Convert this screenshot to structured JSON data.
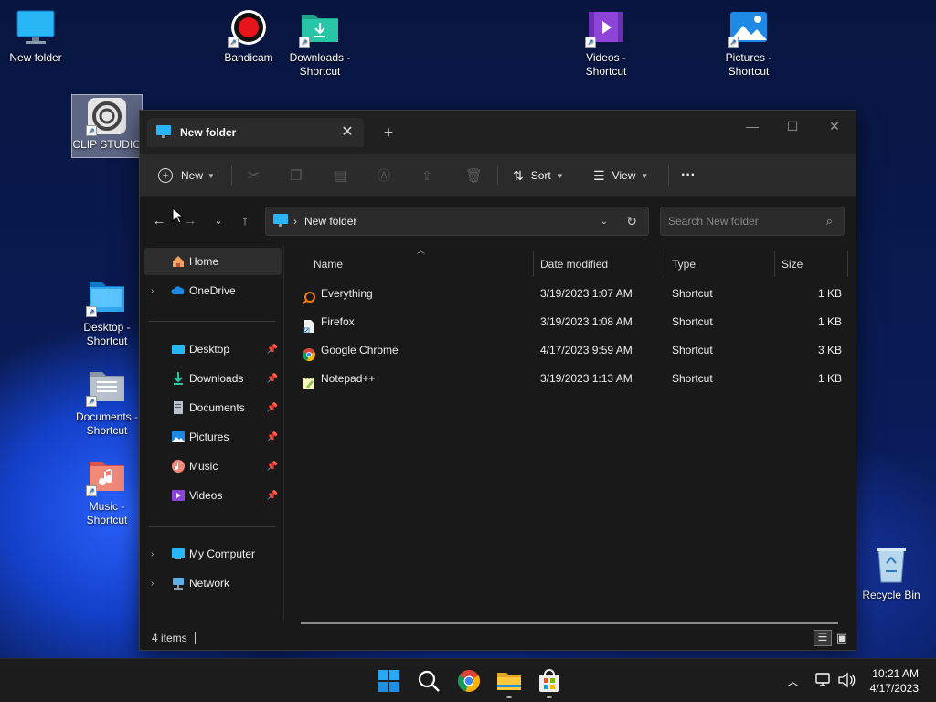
{
  "desktop": {
    "icons": [
      {
        "label": "New folder",
        "type": "folder-monitor"
      },
      {
        "label": "Bandicam",
        "type": "record"
      },
      {
        "label": "Downloads - Shortcut",
        "type": "downloads"
      },
      {
        "label": "Videos - Shortcut",
        "type": "videos"
      },
      {
        "label": "Pictures - Shortcut",
        "type": "pictures"
      },
      {
        "label": "CLIP STUDIO",
        "type": "clipstudio"
      },
      {
        "label": "Desktop - Shortcut",
        "type": "desktop"
      },
      {
        "label": "Documents - Shortcut",
        "type": "documents"
      },
      {
        "label": "Music - Shortcut",
        "type": "music"
      },
      {
        "label": "Recycle Bin",
        "type": "recycle"
      }
    ]
  },
  "window": {
    "tab_title": "New folder",
    "tab_close": "✕",
    "new_tab": "+",
    "controls": {
      "minimize": "—",
      "maximize": "☐",
      "close": "✕"
    }
  },
  "toolbar": {
    "new_label": "New",
    "sort_label": "Sort",
    "view_label": "View",
    "more_label": "···"
  },
  "address": {
    "path": "New folder",
    "search_placeholder": "Search New folder"
  },
  "sidebar": {
    "items": [
      {
        "label": "Home",
        "icon": "home-icon",
        "active": true
      },
      {
        "label": "OneDrive",
        "icon": "onedrive-icon",
        "expandable": true
      },
      {
        "label": "Desktop",
        "icon": "desktop-icon",
        "pinned": true
      },
      {
        "label": "Downloads",
        "icon": "downloads-icon",
        "pinned": true
      },
      {
        "label": "Documents",
        "icon": "documents-icon",
        "pinned": true
      },
      {
        "label": "Pictures",
        "icon": "pictures-icon",
        "pinned": true
      },
      {
        "label": "Music",
        "icon": "music-icon",
        "pinned": true
      },
      {
        "label": "Videos",
        "icon": "videos-icon",
        "pinned": true
      },
      {
        "label": "My Computer",
        "icon": "computer-icon",
        "expandable": true
      },
      {
        "label": "Network",
        "icon": "network-icon",
        "expandable": true
      }
    ]
  },
  "columns": {
    "name": "Name",
    "date": "Date modified",
    "type": "Type",
    "size": "Size"
  },
  "files": [
    {
      "name": "Everything",
      "date": "3/19/2023 1:07 AM",
      "type": "Shortcut",
      "size": "1 KB",
      "icon": "everything-icon"
    },
    {
      "name": "Firefox",
      "date": "3/19/2023 1:08 AM",
      "type": "Shortcut",
      "size": "1 KB",
      "icon": "shortcut-file-icon"
    },
    {
      "name": "Google Chrome",
      "date": "4/17/2023 9:59 AM",
      "type": "Shortcut",
      "size": "3 KB",
      "icon": "chrome-icon"
    },
    {
      "name": "Notepad++",
      "date": "3/19/2023 1:13 AM",
      "type": "Shortcut",
      "size": "1 KB",
      "icon": "notepadpp-icon"
    }
  ],
  "status": {
    "item_count": "4 items"
  },
  "taskbar": {
    "time": "10:21 AM",
    "date": "4/17/2023",
    "apps": [
      "start-icon",
      "search-icon",
      "chrome-icon",
      "file-explorer-icon",
      "store-icon"
    ]
  },
  "colors": {
    "accent": "#0078d4",
    "window_bg": "#191919",
    "toolbar_bg": "#2b2b2b"
  }
}
